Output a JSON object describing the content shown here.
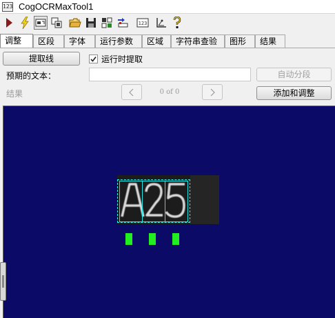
{
  "window": {
    "title": "CogOCRMaxTool1",
    "icon_text": "123"
  },
  "toolbar": {
    "icons": [
      "run-icon",
      "lightning-icon",
      "display-toggle-icon",
      "window-icon",
      "open-folder-icon",
      "save-icon",
      "grid-settings-icon",
      "import-icon",
      "number-display-icon",
      "ruler-icon",
      "help-icon"
    ]
  },
  "tabs": [
    "调整",
    "区段",
    "字体",
    "运行参数",
    "区域",
    "字符串查验",
    "图形",
    "结果"
  ],
  "tabs_active": "调整",
  "form": {
    "extract_button": "提取线",
    "run_extract_label": "运行时提取",
    "run_extract_checked": true,
    "expected_text_label": "预期的文本：",
    "expected_text_value": "",
    "auto_segment_button": "自动分段",
    "result_label": "结果",
    "pager_text": "0 of 0",
    "add_adjust_button": "添加和调整"
  },
  "ocr_display": {
    "recognized": "A25",
    "result_marks": [
      "A",
      "2",
      "5"
    ],
    "colors": {
      "background": "#0b0a66",
      "region": "#2ff0f0",
      "result": "#22ee22"
    }
  }
}
